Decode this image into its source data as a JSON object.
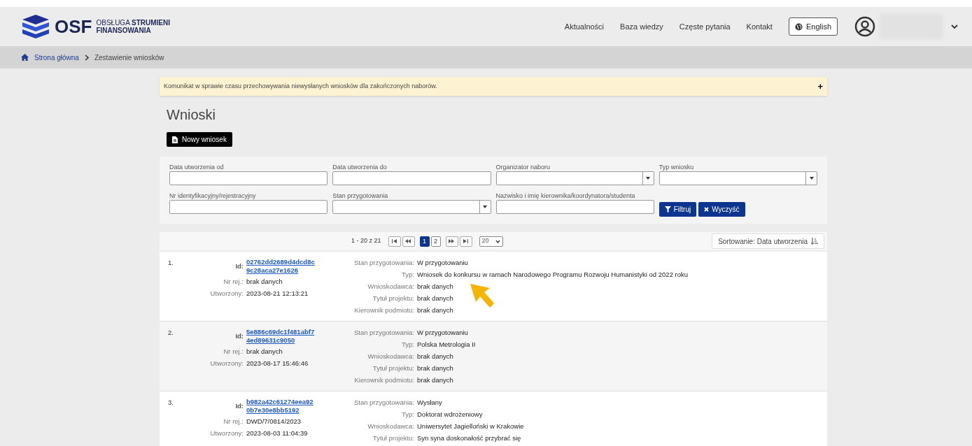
{
  "header": {
    "logo_text": "OSF",
    "logo_subtitle_1": "OBSŁUGA",
    "logo_subtitle_2": "STRUMIENI",
    "logo_subtitle_3": "FINANSOWANIA",
    "nav": [
      "Aktualności",
      "Baza wiedzy",
      "Częste pytania",
      "Kontakt"
    ],
    "language_button": "English"
  },
  "breadcrumb": [
    "Strona główna",
    "Zestawienie wniosków"
  ],
  "notice": {
    "text": "Komunikat w sprawie czasu przechowywania niewysłanych wniosków dla zakończonych naborów.",
    "expand_icon": "+"
  },
  "page_title": "Wnioski",
  "new_button": "Nowy wniosek",
  "filters": [
    {
      "label": "Data utworzenia od",
      "kind": "text"
    },
    {
      "label": "Data utworzenia do",
      "kind": "text"
    },
    {
      "label": "Organizator naboru",
      "kind": "select"
    },
    {
      "label": "Typ wniosku",
      "kind": "select"
    },
    {
      "label": "Nr identyfikacyjny/rejestracyjny",
      "kind": "text"
    },
    {
      "label": "Stan przygotowania",
      "kind": "select"
    },
    {
      "label": "Nazwisko i imię kierownika/koordynatora/studenta",
      "kind": "text"
    }
  ],
  "filter_button": "Filtruj",
  "clear_button": "Wyczyść",
  "pagination": {
    "range": "1 - 20 z 21",
    "pages": [
      {
        "label": "1",
        "selected": true
      },
      {
        "label": "2",
        "selected": false
      }
    ],
    "page_size": "20",
    "sort": "Sortowanie: Data utworzenia"
  },
  "rows": [
    {
      "number": "1.",
      "id_label": "Id:",
      "id": [
        "02762dd2689d4dcd8c",
        "9c28aca27e1626"
      ],
      "meta": [
        [
          "Nr rej.:",
          "brak danych"
        ],
        [
          "Utworzony:",
          "2023-08-21 12:13:21"
        ]
      ],
      "details": [
        [
          "Stan przygotowania:",
          "W przygotowaniu"
        ],
        [
          "Typ:",
          "Wniosek do konkursu w ramach Narodowego Programu Rozwoju Humanistyki od 2022 roku"
        ],
        [
          "Wnioskodawca:",
          "brak danych"
        ],
        [
          "Tytuł projektu:",
          "brak danych"
        ],
        [
          "Kierownik podmiotu:",
          "brak danych"
        ]
      ]
    },
    {
      "number": "2.",
      "id_label": "Id:",
      "id": [
        "5e886c69dc1f481abf7",
        "4ed89631c9050"
      ],
      "meta": [
        [
          "Nr rej.:",
          "brak danych"
        ],
        [
          "Utworzony:",
          "2023-08-17 15:46:46"
        ]
      ],
      "details": [
        [
          "Stan przygotowania:",
          "W przygotowaniu"
        ],
        [
          "Typ:",
          "Polska Metrologia II"
        ],
        [
          "Wnioskodawca:",
          "brak danych"
        ],
        [
          "Tytuł projektu:",
          "brak danych"
        ],
        [
          "Kierownik podmiotu:",
          "brak danych"
        ]
      ]
    },
    {
      "number": "3.",
      "id_label": "Id:",
      "id": [
        "b982a42c61274eea92",
        "0b7e30e8bb5192"
      ],
      "meta": [
        [
          "Nr rej.:",
          "DWD/7/0814/2023"
        ],
        [
          "Utworzony:",
          "2023-08-03 11:04:39"
        ]
      ],
      "details": [
        [
          "Stan przygotowania:",
          "Wysłany"
        ],
        [
          "Typ:",
          "Doktorat wdrożeniowy"
        ],
        [
          "Wnioskodawca:",
          "Uniwersytet Jagielloński w Krakowie"
        ],
        [
          "Tytuł projektu:",
          "Syn syna doskonałość przybrać się"
        ]
      ]
    }
  ]
}
